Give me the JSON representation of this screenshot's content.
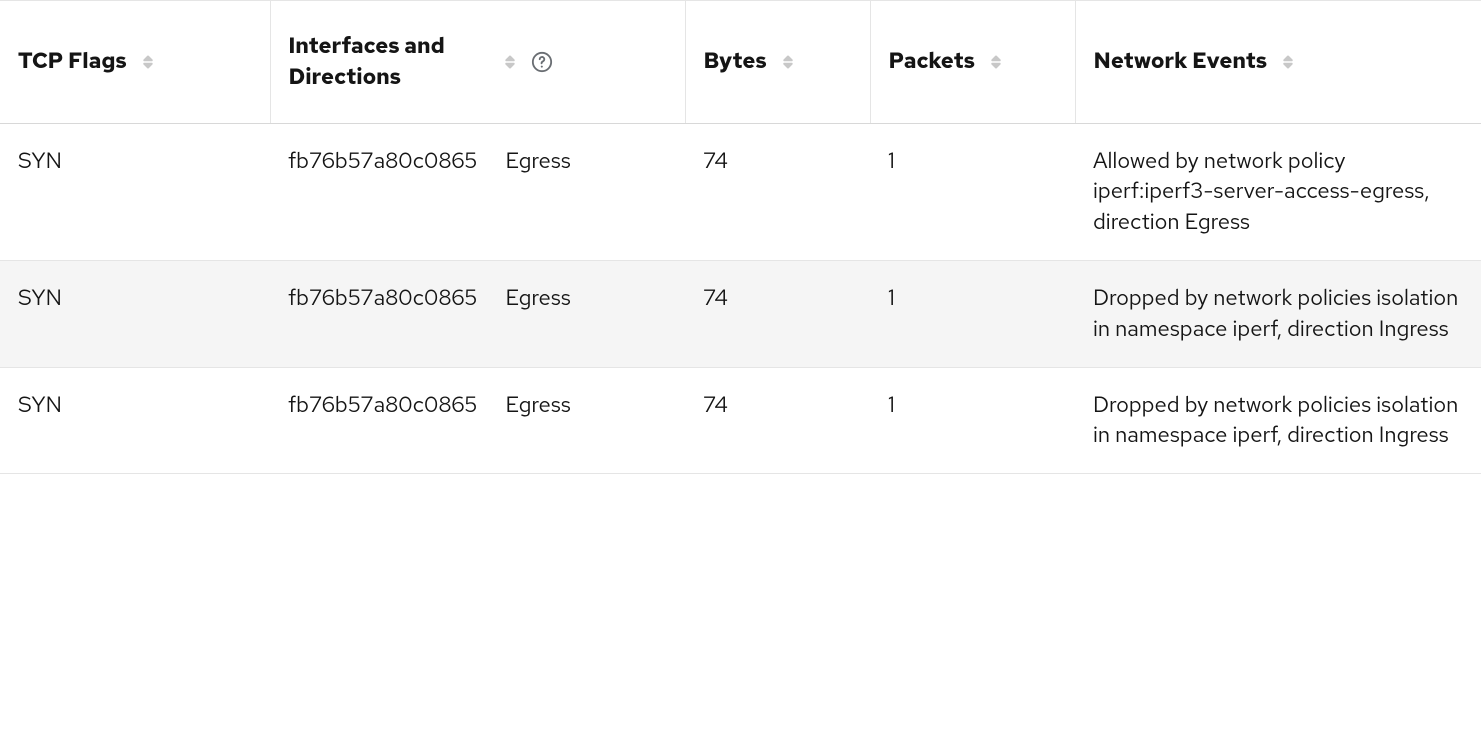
{
  "columns": {
    "tcp_flags": "TCP Flags",
    "interfaces": "Interfaces and Directions",
    "bytes": "Bytes",
    "packets": "Packets",
    "events": "Network Events"
  },
  "rows": [
    {
      "tcp_flags": "SYN",
      "interface": "fb76b57a80c0865",
      "direction": "Egress",
      "bytes": "74",
      "packets": "1",
      "event": "Allowed by network policy iperf:iperf3-server-access-egress, direction Egress"
    },
    {
      "tcp_flags": "SYN",
      "interface": "fb76b57a80c0865",
      "direction": "Egress",
      "bytes": "74",
      "packets": "1",
      "event": "Dropped by network policies isolation in namespace iperf, direction Ingress"
    },
    {
      "tcp_flags": "SYN",
      "interface": "fb76b57a80c0865",
      "direction": "Egress",
      "bytes": "74",
      "packets": "1",
      "event": "Dropped by network policies isolation in namespace iperf, direction Ingress"
    }
  ]
}
